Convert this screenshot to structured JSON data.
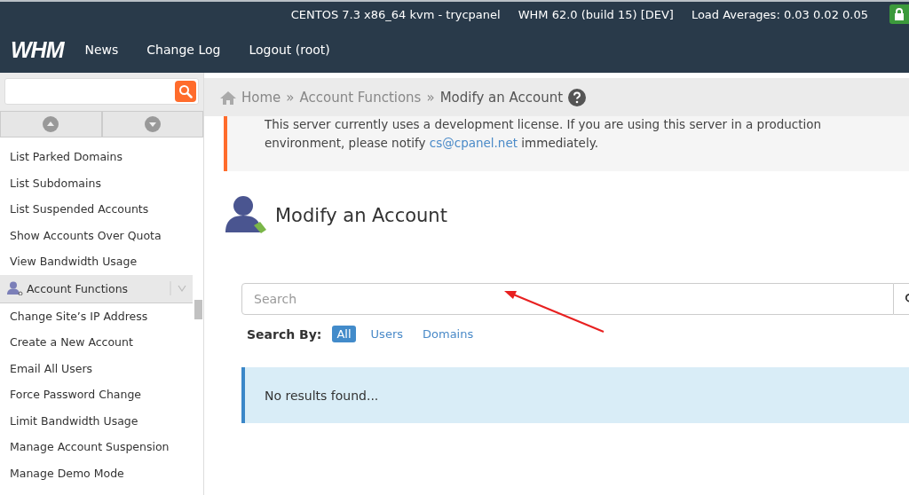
{
  "status_bar": {
    "items": [
      "CENTOS 7.3 x86_64 kvm - trycpanel",
      "WHM 62.0 (build 15) [DEV]",
      "Load Averages: 0.03 0.02 0.05"
    ]
  },
  "header": {
    "logo": "WHM",
    "nav": [
      "News",
      "Change Log",
      "Logout (root)"
    ]
  },
  "breadcrumb": [
    "Home",
    "Account Functions",
    "Modify an Account"
  ],
  "breadcrumb_separator": "»",
  "sidebar": {
    "items": [
      "List Parked Domains",
      "List Subdomains",
      "List Suspended Accounts",
      "Show Accounts Over Quota",
      "View Bandwidth Usage"
    ],
    "section": {
      "title": "Account Functions",
      "items": [
        "Change Site’s IP Address",
        "Create a New Account",
        "Email All Users",
        "Force Password Change",
        "Limit Bandwidth Usage",
        "Manage Account Suspension",
        "Manage Demo Mode"
      ]
    }
  },
  "notice": {
    "before": "This server currently uses a development license. If you are using this server in a production environment, please notify",
    "link": "cs@cpanel.net",
    "after": "immediately."
  },
  "page_title": "Modify an Account",
  "search": {
    "placeholder": "Search"
  },
  "search_by": {
    "label": "Search By:",
    "options": [
      {
        "label": "All",
        "selected": true
      },
      {
        "label": "Users",
        "selected": false
      },
      {
        "label": "Domains",
        "selected": false
      }
    ]
  },
  "results": {
    "message": "No results found..."
  }
}
